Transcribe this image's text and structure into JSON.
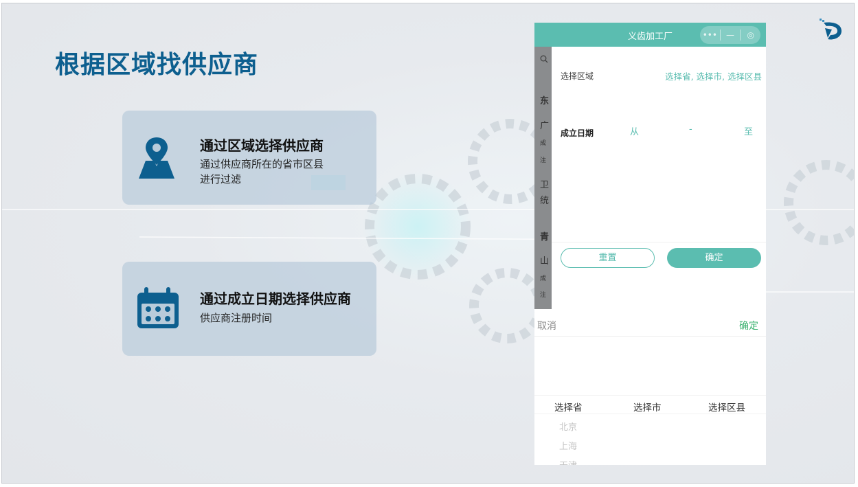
{
  "slide": {
    "title": "根据区域找供应商",
    "cards": [
      {
        "title": "通过区域选择供应商",
        "desc_line1": "通过供应商所在的省市区县",
        "desc_line2": "进行过滤",
        "icon": "map-pin-icon"
      },
      {
        "title": "通过成立日期选择供应商",
        "desc_line1": "供应商注册时间",
        "icon": "calendar-icon"
      }
    ]
  },
  "phone": {
    "app_title": "义齿加工厂",
    "capsule": {
      "more": "•••",
      "minimize": "—",
      "close": "◎"
    },
    "background_list": [
      "东",
      "广",
      "成",
      "注",
      "卫",
      "统",
      "青",
      "山",
      "成",
      "注"
    ],
    "filter": {
      "region_label": "选择区域",
      "region_value": "选择省, 选择市, 选择区县",
      "date_label": "成立日期",
      "date_from": "从",
      "date_dash": "-",
      "date_to": "至",
      "reset_label": "重置",
      "confirm_label": "确定"
    },
    "picker": {
      "cancel_label": "取消",
      "confirm_label": "确定",
      "columns": [
        "选择省",
        "选择市",
        "选择区县"
      ],
      "province_options": [
        "北京",
        "上海",
        "天津"
      ]
    }
  },
  "colors": {
    "accent": "#5bbdb0",
    "title_blue": "#0d5f8f",
    "confirm_green": "#3cb371"
  }
}
